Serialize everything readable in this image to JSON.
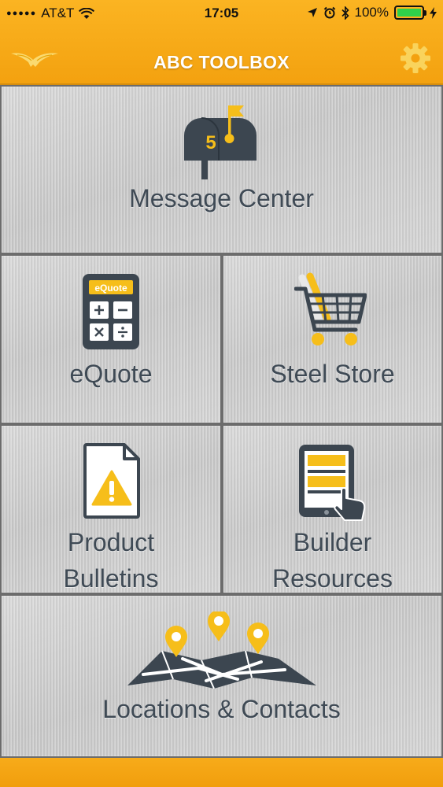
{
  "status_bar": {
    "carrier": "AT&T",
    "time": "17:05",
    "battery": "100%",
    "battery_level": 1.0
  },
  "header": {
    "title": "ABC TOOLBOX",
    "logo_icon": "eagle-logo-icon",
    "settings_icon": "gear-icon"
  },
  "tiles": {
    "message_center": {
      "label": "Message Center",
      "badge": "5",
      "icon": "mailbox-icon"
    },
    "equote": {
      "label": "eQuote",
      "screen_text": "eQuote",
      "icon": "calculator-icon"
    },
    "steel_store": {
      "label": "Steel Store",
      "icon": "shopping-cart-icon"
    },
    "product_bulletins": {
      "label_line1": "Product",
      "label_line2": "Bulletins",
      "icon": "warning-document-icon"
    },
    "builder_resources": {
      "label_line1": "Builder",
      "label_line2": "Resources",
      "icon": "tablet-touch-icon"
    },
    "locations_contacts": {
      "label": "Locations & Contacts",
      "icon": "map-pins-icon"
    }
  },
  "colors": {
    "accent": "#F6A818",
    "tile_text": "#3F4A55",
    "icon_dark": "#3C4650",
    "icon_yellow": "#F6BE1A"
  }
}
